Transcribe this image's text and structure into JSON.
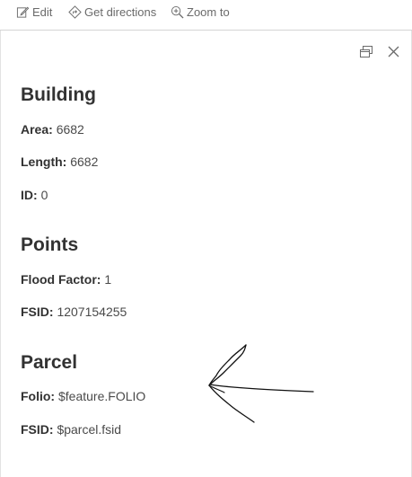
{
  "toolbar": {
    "edit_label": "Edit",
    "directions_label": "Get directions",
    "zoom_label": "Zoom to"
  },
  "sections": {
    "building": {
      "title": "Building",
      "area_key": "Area:",
      "area_value": "6682",
      "length_key": "Length:",
      "length_value": "6682",
      "id_key": "ID:",
      "id_value": "0"
    },
    "points": {
      "title": "Points",
      "flood_key": "Flood Factor:",
      "flood_value": "1",
      "fsid_key": "FSID:",
      "fsid_value": "1207154255"
    },
    "parcel": {
      "title": "Parcel",
      "folio_key": "Folio:",
      "folio_value": "$feature.FOLIO",
      "fsid_key": "FSID:",
      "fsid_value": "$parcel.fsid"
    }
  },
  "colors": {
    "text": "#323232",
    "muted": "#6a6a6a",
    "border": "#d4d4d4"
  }
}
